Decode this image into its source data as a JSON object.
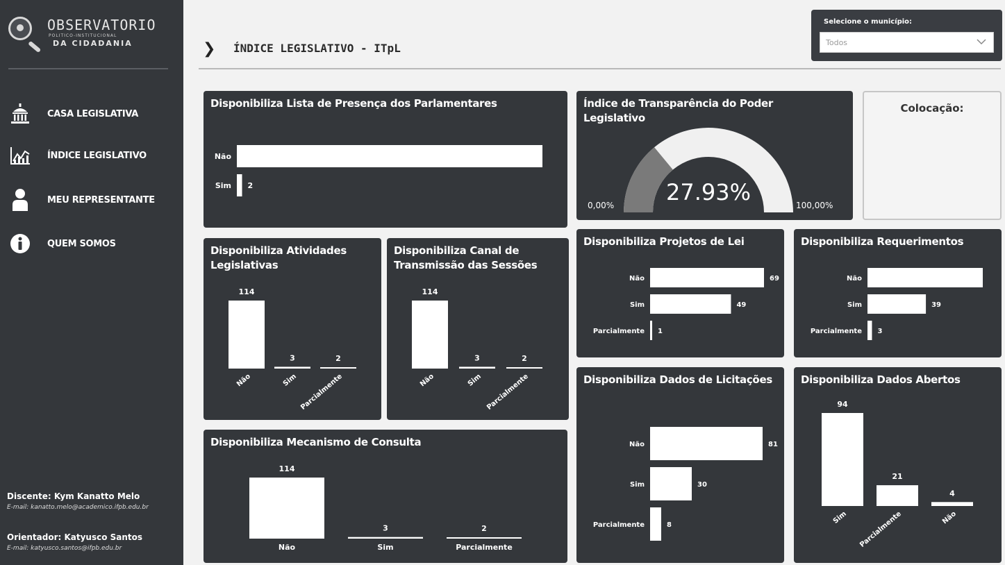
{
  "logo": {
    "title": "OBSERVATORIO",
    "subtitle": "POLITICO-INSTITUCIONAL",
    "tagline": "DA CIDADANIA"
  },
  "nav": [
    {
      "label": "CASA LEGISLATIVA",
      "icon": "building-icon"
    },
    {
      "label": "ÍNDICE LEGISLATIVO",
      "icon": "line-chart-icon"
    },
    {
      "label": "MEU REPRESENTANTE",
      "icon": "person-icon"
    },
    {
      "label": "QUEM SOMOS",
      "icon": "info-icon"
    }
  ],
  "credits": {
    "student_name": "Discente: Kym Kanatto Melo",
    "student_email": "E-mail: kanatto.melo@academico.ifpb.edu.br",
    "advisor_name": "Orientador: Katyusco Santos",
    "advisor_email": "E-mail: katyusco.santos@ifpb.edu.br"
  },
  "header": {
    "title": "ÍNDICE LEGISLATIVO - ITpL"
  },
  "filter": {
    "label": "Selecione o município:",
    "value": "Todos"
  },
  "colors": {
    "sidebar": "#34373b",
    "card": "#34373b",
    "bar": "#ffffff",
    "gauge_fill": "#7a7a7a",
    "gauge_track": "#f0f0f0"
  },
  "gauge": {
    "title": "Índice de Transparência do Poder Legislativo",
    "value_label": "27.93%",
    "value": 27.93,
    "min_label": "0,00%",
    "max_label": "100,00%",
    "min": 0,
    "max": 100
  },
  "colocacao": {
    "title": "Colocação:"
  },
  "chart_data": [
    {
      "id": "presenca",
      "type": "bar",
      "orientation": "horizontal",
      "title": "Disponibiliza Lista de Presença dos Parlamentares",
      "categories": [
        "Não",
        "Sim"
      ],
      "values": [
        117,
        2
      ],
      "data_labels": [
        "",
        "2"
      ]
    },
    {
      "id": "atividades",
      "type": "bar",
      "orientation": "vertical",
      "title": "Disponibiliza Atividades Legislativas",
      "categories": [
        "Não",
        "Sim",
        "Parcialmente"
      ],
      "values": [
        114,
        3,
        2
      ],
      "data_labels": [
        "114",
        "3",
        "2"
      ]
    },
    {
      "id": "canal",
      "type": "bar",
      "orientation": "vertical",
      "title": "Disponibiliza Canal de Transmissão das Sessões",
      "categories": [
        "Não",
        "Sim",
        "Parcialmente"
      ],
      "values": [
        114,
        3,
        2
      ],
      "data_labels": [
        "114",
        "3",
        "2"
      ]
    },
    {
      "id": "consulta",
      "type": "bar",
      "orientation": "vertical",
      "title": "Disponibiliza Mecanismo de Consulta",
      "categories": [
        "Não",
        "Sim",
        "Parcialmente"
      ],
      "values": [
        114,
        3,
        2
      ],
      "data_labels": [
        "114",
        "3",
        "2"
      ]
    },
    {
      "id": "projetos",
      "type": "bar",
      "orientation": "horizontal",
      "title": "Disponibiliza Projetos de Lei",
      "categories": [
        "Não",
        "Sim",
        "Parcialmente"
      ],
      "values": [
        69,
        49,
        1
      ],
      "data_labels": [
        "69",
        "49",
        "1"
      ]
    },
    {
      "id": "requerimentos",
      "type": "bar",
      "orientation": "horizontal",
      "title": "Disponibiliza Requerimentos",
      "categories": [
        "Não",
        "Sim",
        "Parcialmente"
      ],
      "values": [
        77,
        39,
        3
      ],
      "data_labels": [
        "",
        "39",
        "3"
      ]
    },
    {
      "id": "licitacoes",
      "type": "bar",
      "orientation": "horizontal",
      "title": "Disponibiliza Dados de Licitações",
      "categories": [
        "Não",
        "Sim",
        "Parcialmente"
      ],
      "values": [
        81,
        30,
        8
      ],
      "data_labels": [
        "81",
        "30",
        "8"
      ]
    },
    {
      "id": "abertos",
      "type": "bar",
      "orientation": "vertical",
      "title": "Disponibiliza Dados Abertos",
      "categories": [
        "Sim",
        "Parcialmente",
        "Não"
      ],
      "values": [
        94,
        21,
        4
      ],
      "data_labels": [
        "94",
        "21",
        "4"
      ]
    }
  ]
}
